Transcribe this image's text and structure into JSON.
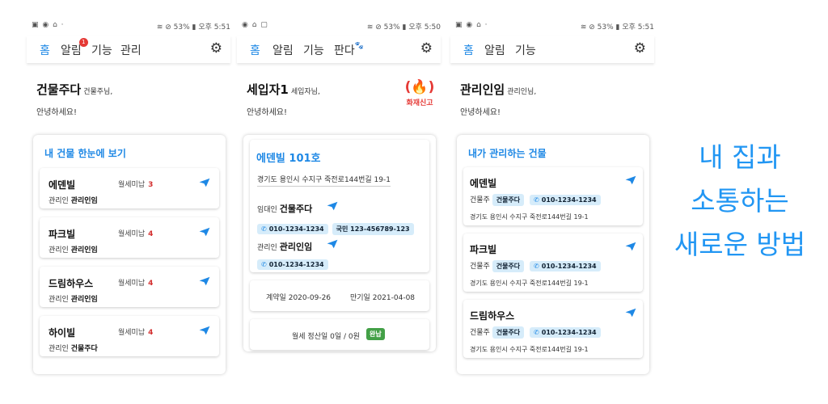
{
  "screens": [
    {
      "status": {
        "left": "▣ ◉ ⌂ ·",
        "right": "≋ ⊘ 53% ▮ 오후 5:51"
      },
      "tabs": [
        "홈",
        "알림",
        "기능",
        "관리"
      ],
      "badge": "1",
      "greet": {
        "name": "건물주다",
        "suffix": "건물주님,",
        "hello": "안녕하세요!"
      },
      "panel_title": "내 건물 한눈에 보기",
      "buildings": [
        {
          "name": "에덴빌",
          "unpaid_label": "월세미납",
          "unpaid": "3",
          "mgr_label": "관리인",
          "mgr": "관리인임"
        },
        {
          "name": "파크빌",
          "unpaid_label": "월세미납",
          "unpaid": "4",
          "mgr_label": "관리인",
          "mgr": "관리인임"
        },
        {
          "name": "드림하우스",
          "unpaid_label": "월세미납",
          "unpaid": "4",
          "mgr_label": "관리인",
          "mgr": "관리인임"
        },
        {
          "name": "하이빌",
          "unpaid_label": "월세미납",
          "unpaid": "4",
          "mgr_label": "관리인",
          "mgr": "건물주다"
        }
      ]
    },
    {
      "status": {
        "left": "◉ ⌂ ▢",
        "right": "≋ ⊘ 53% ▮ 오후 5:50"
      },
      "tabs": [
        "홈",
        "알림",
        "기능",
        "판다"
      ],
      "paw": "🐾",
      "greet": {
        "name": "세입자1",
        "suffix": "세입자님,",
        "hello": "안녕하세요!"
      },
      "fire": {
        "icon": "(🔥)",
        "label": "화재신고"
      },
      "unit": {
        "title": "에덴빌 101호",
        "address": "경기도 용인시 수지구 죽전로144번길 19-1",
        "landlord_label": "임대인",
        "landlord": "건물주다",
        "landlord_phone": "010-1234-1234",
        "landlord_id": "국민 123-456789-123",
        "manager_label": "관리인",
        "manager": "관리인임",
        "manager_phone": "010-1234-1234"
      },
      "contract": {
        "label": "계약일",
        "date": "2020-09-26",
        "end_label": "만기일",
        "end": "2021-04-08"
      },
      "rent": {
        "text": "월세 정산일 0일 / 0원",
        "status": "완납"
      }
    },
    {
      "status": {
        "left": "▣ ◉ ⌂ ·",
        "right": "≋ ⊘ 53% ▮ 오후 5:51"
      },
      "tabs": [
        "홈",
        "알림",
        "기능"
      ],
      "greet": {
        "name": "관리인임",
        "suffix": "관리인님,",
        "hello": "안녕하세요!"
      },
      "panel_title": "내가 관리하는 건물",
      "buildings": [
        {
          "name": "에덴빌",
          "owner_label": "건물주",
          "owner": "건물주다",
          "phone": "010-1234-1234",
          "address": "경기도 용인시 수지구 죽전로144번길 19-1"
        },
        {
          "name": "파크빌",
          "owner_label": "건물주",
          "owner": "건물주다",
          "phone": "010-1234-1234",
          "address": "경기도 용인시 수지구 죽전로144번길 19-1"
        },
        {
          "name": "드림하우스",
          "owner_label": "건물주",
          "owner": "건물주다",
          "phone": "010-1234-1234",
          "address": "경기도 용인시 수지구 죽전로144번길 19-1"
        }
      ]
    }
  ],
  "icons": {
    "gear": "gear-icon",
    "send": "send-icon",
    "phone": "phone-icon",
    "fire": "fire-icon"
  },
  "colors": {
    "accent": "#1e88e5",
    "alert": "#e53935",
    "paid": "#43a047",
    "chip": "#d6ecfa"
  },
  "slogan": [
    "내 집과",
    "소통하는",
    "새로운 방법"
  ]
}
